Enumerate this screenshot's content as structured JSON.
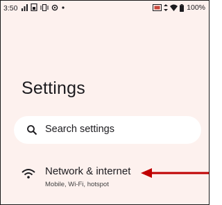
{
  "status_bar": {
    "time": "3:50",
    "battery": "100%",
    "icons": [
      "signal-icon",
      "sim-icon",
      "vibrate-icon",
      "settings-gear-icon",
      "dot-icon",
      "cast-icon",
      "data-icon",
      "wifi-icon",
      "battery-icon"
    ]
  },
  "page": {
    "title": "Settings"
  },
  "search": {
    "placeholder": "Search settings",
    "icon": "search-icon"
  },
  "items": [
    {
      "title": "Network & internet",
      "subtitle": "Mobile, Wi-Fi, hotspot",
      "icon": "wifi-icon"
    }
  ],
  "colors": {
    "background": "#fdf1ee",
    "search_bg": "#ffffff",
    "text": "#1c1b1f",
    "annotation_arrow": "#c00000"
  }
}
